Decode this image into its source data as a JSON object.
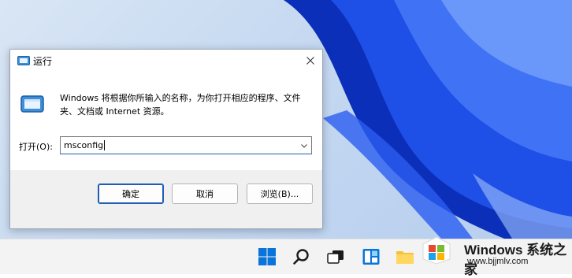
{
  "dialog": {
    "title": "运行",
    "description": "Windows 将根据你所输入的名称，为你打开相应的程序、文件夹、文档或 Internet 资源。",
    "open_label": "打开(O):",
    "open_value": "msconfig",
    "buttons": {
      "ok": "确定",
      "cancel": "取消",
      "browse": "浏览(B)..."
    }
  },
  "watermark": {
    "title": "Windows 系统之家",
    "url": "www.bjjmlv.com"
  },
  "icons": {
    "run": "run-icon",
    "close": "close-icon",
    "dropdown": "chevron-down-icon",
    "taskbar": [
      "start-icon",
      "search-icon",
      "task-view-icon",
      "widgets-icon",
      "file-explorer-icon"
    ]
  },
  "colors": {
    "accent": "#1f5eb4",
    "wallpaper": "#1240d8",
    "taskbar": "#f3f3f3"
  }
}
